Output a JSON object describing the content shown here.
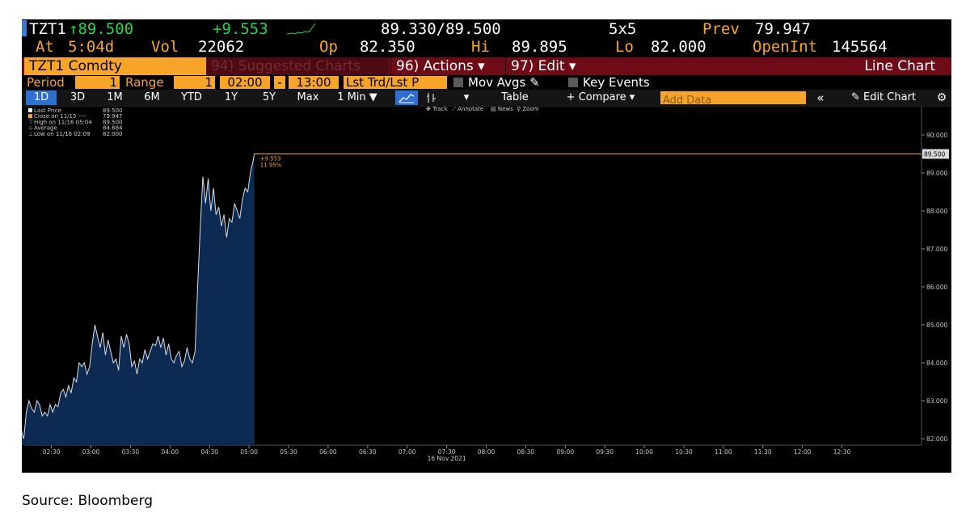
{
  "header": {
    "ticker": "TZT1",
    "last_price": "↑89.500",
    "change": "+9.553",
    "bid_ask": "89.330/89.500",
    "size": "5x5",
    "prev_label": "Prev",
    "prev_value": "79.947",
    "at_label": "At",
    "at_time": "5:04d",
    "vol_label": "Vol",
    "vol_value": "22062",
    "op_label": "Op",
    "op_value": "82.350",
    "hi_label": "Hi",
    "hi_value": "89.895",
    "lo_label": "Lo",
    "lo_value": "82.000",
    "oi_label": "OpenInt",
    "oi_value": "145564"
  },
  "menubar": {
    "security": "TZT1 Comdty",
    "suggested": "94) Suggested Charts",
    "actions": "96) Actions ▾",
    "edit": "97) Edit ▾",
    "chart_type": "Line Chart"
  },
  "settings": {
    "period_label": "Period",
    "period_value": "1",
    "range_label": "Range",
    "range_value": "1",
    "start_time": "02:00",
    "dash": "-",
    "end_time": "13:00",
    "field": "Lst Trd/Lst P",
    "mov_avgs": "Mov Avgs",
    "key_events": "Key Events"
  },
  "toolbar": {
    "ranges": [
      "1D",
      "3D",
      "1M",
      "6M",
      "YTD",
      "1Y",
      "5Y",
      "Max"
    ],
    "interval": "1 Min ▼",
    "line_icon": "line-chart-icon",
    "bar_icon": "bar-chart-icon",
    "table": "Table",
    "compare": "+ Compare ▾",
    "add_data_placeholder": "Add Data",
    "collapse": "«",
    "edit_chart": "Edit Chart",
    "settings_icon": "gear-icon",
    "track": "Track",
    "annotate": "Annotate",
    "news": "News",
    "zoom": "Zoom"
  },
  "legend": {
    "rows": [
      {
        "label": "Last Price",
        "value": "89.500"
      },
      {
        "label": "Close on 11/15 ----",
        "value": "79.947"
      },
      {
        "label": "High on 11/16 05:04",
        "value": "89.500"
      },
      {
        "label": "Average",
        "value": "84.684"
      },
      {
        "label": "Low on 11/16 02:09",
        "value": "82.000"
      }
    ]
  },
  "annotation": {
    "change": "+9.553",
    "pct": "11.95%",
    "last_tag": "89.500"
  },
  "colors": {
    "background": "#000000",
    "amber": "#f7a52a",
    "line": "#d8dde8",
    "fill": "#0d2b52",
    "menubar": "#6e0b16"
  },
  "chart_data": {
    "type": "area",
    "x_ticks": [
      "02:30",
      "03:00",
      "03:30",
      "04:00",
      "04:30",
      "05:00",
      "05:30",
      "06:00",
      "06:30",
      "07:00",
      "07:30",
      "08:00",
      "08:30",
      "09:00",
      "09:30",
      "10:00",
      "10:30",
      "11:00",
      "11:30",
      "12:00",
      "12:30"
    ],
    "x_date_label": "16 Nov 2021",
    "y_ticks": [
      "82.000",
      "83.000",
      "84.000",
      "85.000",
      "86.000",
      "87.000",
      "88.000",
      "89.000",
      "90.000"
    ],
    "ylim": [
      81.3,
      90.1
    ],
    "xlim": [
      "02:00",
      "13:00"
    ],
    "series": [
      {
        "name": "Last Price",
        "x": [
          "02:00",
          "02:02",
          "02:04",
          "02:06",
          "02:08",
          "02:09",
          "02:11",
          "02:13",
          "02:15",
          "02:17",
          "02:19",
          "02:21",
          "02:23",
          "02:25",
          "02:27",
          "02:29",
          "02:31",
          "02:33",
          "02:35",
          "02:37",
          "02:39",
          "02:41",
          "02:43",
          "02:45",
          "02:47",
          "02:49",
          "02:51",
          "02:53",
          "02:55",
          "02:57",
          "02:59",
          "03:01",
          "03:03",
          "03:05",
          "03:07",
          "03:09",
          "03:11",
          "03:13",
          "03:15",
          "03:17",
          "03:19",
          "03:21",
          "03:23",
          "03:25",
          "03:27",
          "03:29",
          "03:31",
          "03:33",
          "03:35",
          "03:37",
          "03:39",
          "03:41",
          "03:43",
          "03:45",
          "03:47",
          "03:49",
          "03:51",
          "03:53",
          "03:55",
          "03:57",
          "03:59",
          "04:01",
          "04:03",
          "04:05",
          "04:07",
          "04:09",
          "04:11",
          "04:13",
          "04:15",
          "04:17",
          "04:19",
          "04:21",
          "04:23",
          "04:25",
          "04:27",
          "04:29",
          "04:31",
          "04:33",
          "04:35",
          "04:37",
          "04:39",
          "04:41",
          "04:43",
          "04:45",
          "04:47",
          "04:49",
          "04:51",
          "04:53",
          "04:55",
          "04:57",
          "04:59",
          "05:01",
          "05:03",
          "05:04"
        ],
        "values": [
          83.0,
          82.8,
          82.2,
          82.5,
          82.1,
          82.0,
          82.7,
          83.0,
          82.8,
          82.7,
          83.0,
          82.9,
          82.6,
          82.7,
          82.6,
          82.9,
          82.7,
          82.9,
          82.85,
          83.2,
          83.3,
          83.1,
          83.4,
          83.2,
          83.6,
          83.5,
          84.0,
          83.9,
          84.0,
          83.7,
          83.9,
          84.5,
          85.0,
          84.7,
          84.4,
          84.8,
          84.2,
          84.6,
          84.3,
          84.0,
          84.1,
          83.8,
          84.7,
          84.4,
          84.75,
          84.5,
          83.9,
          84.05,
          83.7,
          84.1,
          84.0,
          84.35,
          84.1,
          84.3,
          84.5,
          84.45,
          84.7,
          84.4,
          84.65,
          84.2,
          84.5,
          84.1,
          84.0,
          84.2,
          84.3,
          83.9,
          84.05,
          84.4,
          84.1,
          84.0,
          84.3,
          86.0,
          87.6,
          88.9,
          88.2,
          88.85,
          88.0,
          88.6,
          87.9,
          88.1,
          87.6,
          87.9,
          87.3,
          87.8,
          87.7,
          88.2,
          88.0,
          87.8,
          88.3,
          88.6,
          88.5,
          89.0,
          89.3,
          89.5
        ]
      }
    ],
    "reference_lines": [
      {
        "label": "Last Price",
        "value": 89.5
      }
    ],
    "grid": false,
    "legend_position": "top-left"
  },
  "footer": {
    "source": "Source: Bloomberg"
  }
}
